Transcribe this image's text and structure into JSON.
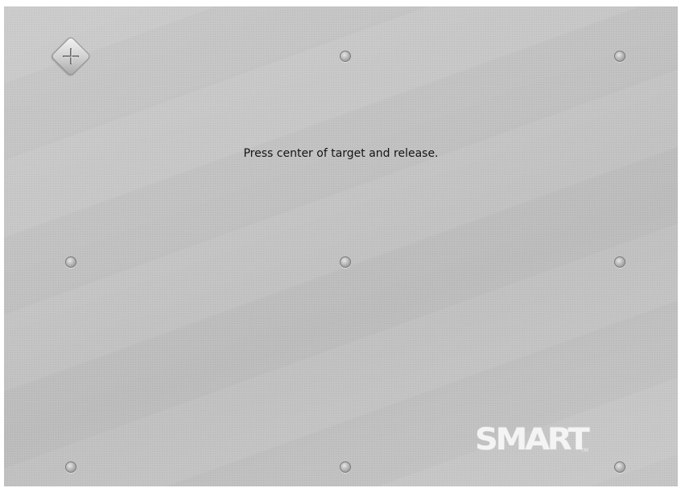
{
  "calibration": {
    "instruction": "Press center of target and release.",
    "logo_text": "SMART",
    "trademark": "TM",
    "background_color": "#c3c3c3",
    "points": [
      {
        "id": "top-left",
        "state": "active-target"
      },
      {
        "id": "top-center",
        "state": "pending"
      },
      {
        "id": "top-right",
        "state": "pending"
      },
      {
        "id": "middle-left",
        "state": "pending"
      },
      {
        "id": "middle-center",
        "state": "pending"
      },
      {
        "id": "middle-right",
        "state": "pending"
      },
      {
        "id": "bottom-left",
        "state": "pending"
      },
      {
        "id": "bottom-center",
        "state": "pending"
      },
      {
        "id": "bottom-right",
        "state": "pending"
      }
    ]
  }
}
